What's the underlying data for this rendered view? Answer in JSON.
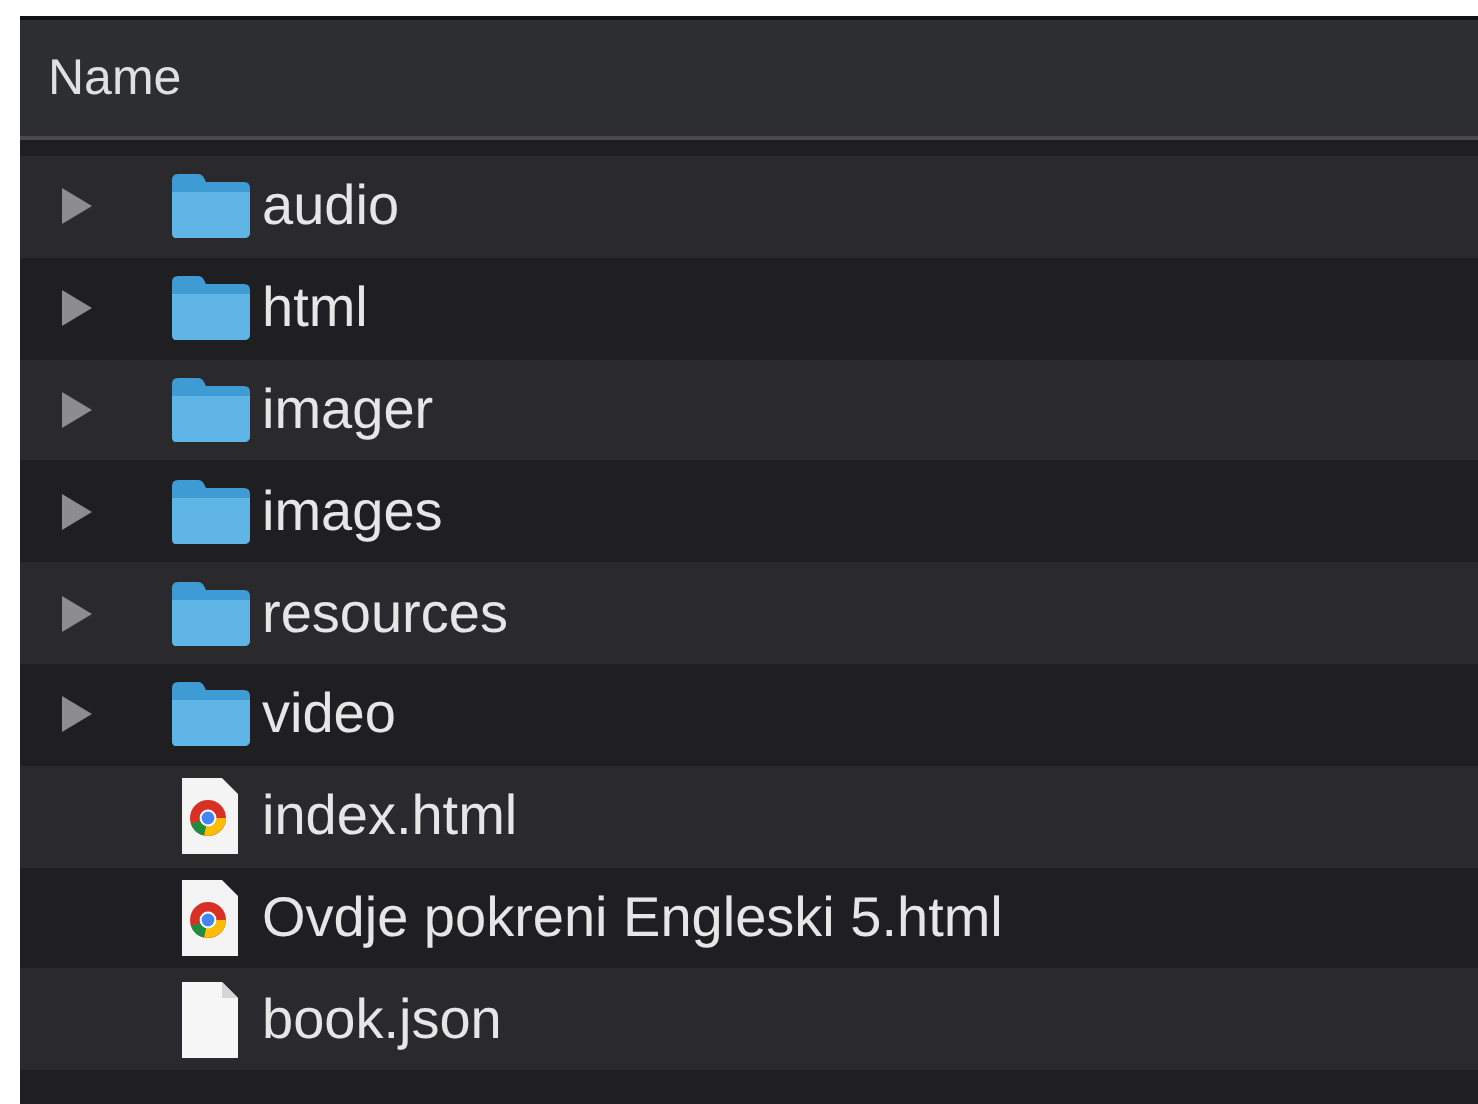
{
  "table": {
    "columns": [
      "Name"
    ],
    "rows": [
      {
        "name": "audio",
        "kind": "folder"
      },
      {
        "name": "html",
        "kind": "folder"
      },
      {
        "name": "imager",
        "kind": "folder"
      },
      {
        "name": "images",
        "kind": "folder"
      },
      {
        "name": "resources",
        "kind": "folder"
      },
      {
        "name": "video",
        "kind": "folder"
      },
      {
        "name": "index.html",
        "kind": "web"
      },
      {
        "name": "Ovdje pokreni Engleski 5.html",
        "kind": "web"
      },
      {
        "name": "book.json",
        "kind": "file"
      }
    ]
  }
}
